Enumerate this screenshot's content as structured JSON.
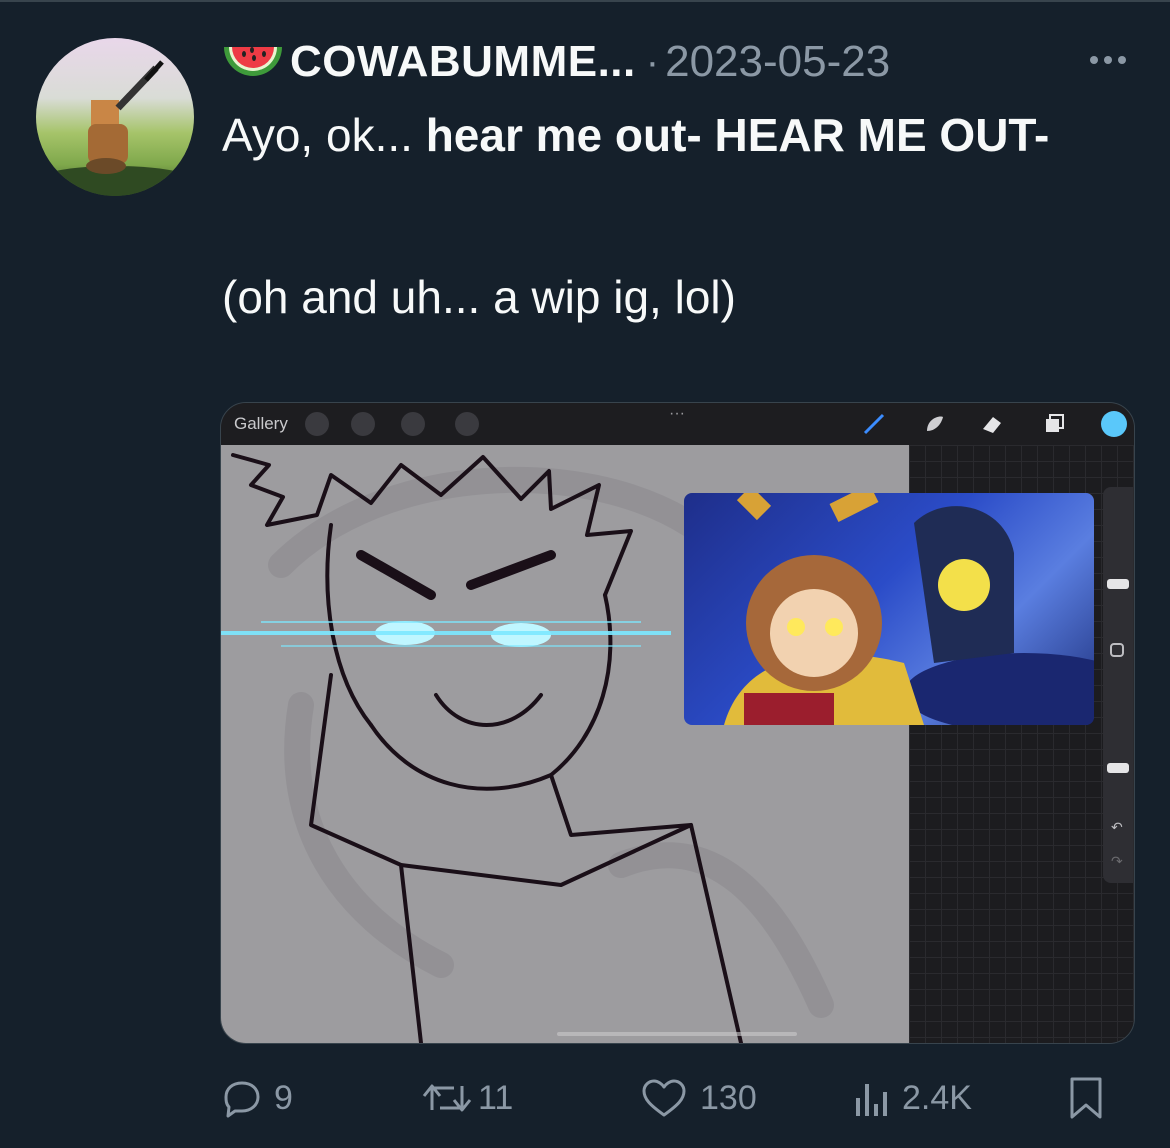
{
  "tweet": {
    "display_name": "COWABUMME...",
    "separator": "·",
    "date": "2023-05-23",
    "text_line1_normal": "Ayo, ok... ",
    "text_line1_bold": "hear me out- HEAR ME OUT-",
    "text_line2": "(oh and uh... a wip ig, lol)"
  },
  "media": {
    "toolbar": {
      "gallery_label": "Gallery",
      "more_glyph": "···",
      "color_swatch": "#5ac8fa"
    },
    "sidebar": {
      "undo_glyph": "↶",
      "redo_glyph": "↷"
    }
  },
  "actions": {
    "replies": "9",
    "retweets": "11",
    "likes": "130",
    "views": "2.4K"
  },
  "icons": [
    "watermelon-icon",
    "more-icon",
    "wrench-icon",
    "magic-wand-icon",
    "selection-icon",
    "transform-arrow-icon",
    "brush-icon",
    "smudge-icon",
    "eraser-icon",
    "layers-icon",
    "reply-icon",
    "retweet-icon",
    "like-icon",
    "views-icon",
    "bookmark-icon"
  ],
  "colors": {
    "background": "#15202b",
    "text": "#f7f9f9",
    "muted": "#8b98a5",
    "glow": "#7ce8ff"
  }
}
